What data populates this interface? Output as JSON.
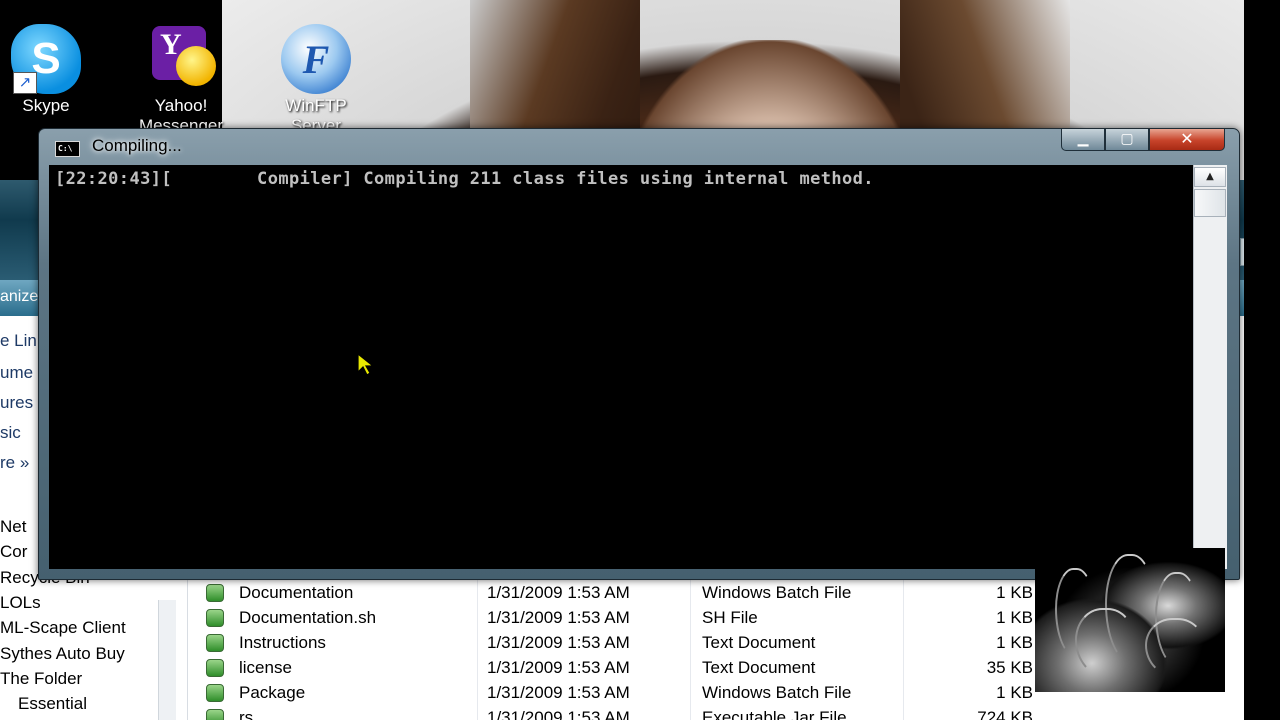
{
  "desktop": {
    "icons": [
      {
        "label": "Skype"
      },
      {
        "label": "Yahoo! Messenger"
      },
      {
        "label": "WinFTP Server"
      }
    ]
  },
  "explorer": {
    "organize_label": "anize",
    "nav_items": [
      {
        "label": "e Lin"
      },
      {
        "label": "ume"
      },
      {
        "label": "ures"
      },
      {
        "label": "sic"
      },
      {
        "label": "re »"
      },
      {
        "label": "Net"
      },
      {
        "label": "Cor"
      },
      {
        "label": "Recycle Bin"
      },
      {
        "label": "LOLs"
      },
      {
        "label": "ML-Scape Client"
      },
      {
        "label": "Sythes Auto Buy"
      },
      {
        "label": "The Folder"
      },
      {
        "label": "Essential"
      }
    ],
    "files": [
      {
        "name": "Documentation",
        "date": "1/31/2009 1:53 AM",
        "type": "Windows Batch File",
        "size": "1 KB"
      },
      {
        "name": "Documentation.sh",
        "date": "1/31/2009 1:53 AM",
        "type": "SH File",
        "size": "1 KB"
      },
      {
        "name": "Instructions",
        "date": "1/31/2009 1:53 AM",
        "type": "Text Document",
        "size": "1 KB"
      },
      {
        "name": "license",
        "date": "1/31/2009 1:53 AM",
        "type": "Text Document",
        "size": "35 KB"
      },
      {
        "name": "Package",
        "date": "1/31/2009 1:53 AM",
        "type": "Windows Batch File",
        "size": "1 KB"
      },
      {
        "name": "rs",
        "date": "1/31/2009 1:53 AM",
        "type": "Executable Jar File",
        "size": "724 KB"
      }
    ]
  },
  "console": {
    "title": "Compiling...",
    "output_line": "[22:20:43][        Compiler] Compiling 211 class files using internal method.",
    "sys_icon": "cmd-icon",
    "colors": {
      "background": "#000000",
      "text": "#c0c0c0"
    }
  }
}
